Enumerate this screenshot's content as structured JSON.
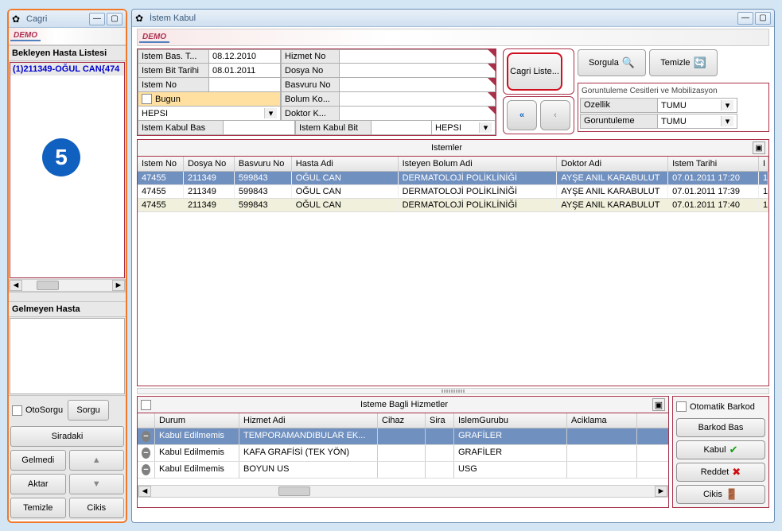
{
  "left": {
    "title": "Cagri",
    "logo": "DEMO",
    "section1": "Bekleyen Hasta Listesi",
    "waiting": [
      "(1)211349-OĞUL CAN{474"
    ],
    "big_number": "5",
    "section2": "Gelmeyen Hasta",
    "otosorgu": "OtoSorgu",
    "buttons": {
      "sorgu": "Sorgu",
      "siradaki": "Siradaki",
      "gelmedi": "Gelmedi",
      "aktar": "Aktar",
      "temizle": "Temizle",
      "cikis": "Cikis"
    }
  },
  "right": {
    "title": "İstem Kabul",
    "logo": "DEMO",
    "form": {
      "istem_bas_t_label": "Istem Bas. T...",
      "istem_bas_t": "08.12.2010",
      "istem_bit_label": "Istem Bit Tarihi",
      "istem_bit": "08.01.2011",
      "istem_no_label": "Istem No",
      "istem_no": "",
      "bugun": "Bugun",
      "hepsi": "HEPSI",
      "hizmet_no_label": "Hizmet No",
      "dosya_no_label": "Dosya No",
      "basvuru_no_label": "Basvuru No",
      "bolum_ko_label": "Bolum Ko...",
      "doktor_k_label": "Doktor K...",
      "istem_kabul_bas": "Istem Kabul Bas",
      "istem_kabul_bit": "Istem Kabul Bit",
      "hepsi2": "HEPSI"
    },
    "cagri_liste": "Cagri Liste...",
    "sorgula": "Sorgula",
    "temizle": "Temizle",
    "gorunt": {
      "title": "Goruntuleme Cesitleri ve Mobilizasyon",
      "ozellik_label": "Ozellik",
      "ozellik": "TUMU",
      "goruntuleme_label": "Goruntuleme",
      "goruntuleme": "TUMU"
    },
    "grid_title": "Istemler",
    "grid_cols": {
      "istem_no": "Istem No",
      "dosya_no": "Dosya No",
      "basvuru_no": "Basvuru No",
      "hasta_adi": "Hasta Adi",
      "isteyen_bolum": "Isteyen Bolum Adi",
      "doktor_adi": "Doktor Adi",
      "istem_tarihi": "Istem Tarihi",
      "i": "I"
    },
    "grid_rows": [
      {
        "istem": "47455",
        "dosya": "211349",
        "basv": "599843",
        "hasta": "OĞUL CAN",
        "bolum": "DERMATOLOJİ POLİKLİNİĞİ",
        "doktor": "AYŞE ANIL KARABULUT",
        "tarih": "07.01.2011 17:20",
        "i": "1"
      },
      {
        "istem": "47455",
        "dosya": "211349",
        "basv": "599843",
        "hasta": "OĞUL CAN",
        "bolum": "DERMATOLOJİ POLİKLİNİĞİ",
        "doktor": "AYŞE ANIL KARABULUT",
        "tarih": "07.01.2011 17:39",
        "i": "1"
      },
      {
        "istem": "47455",
        "dosya": "211349",
        "basv": "599843",
        "hasta": "OĞUL CAN",
        "bolum": "DERMATOLOJİ POLİKLİNİĞİ",
        "doktor": "AYŞE ANIL KARABULUT",
        "tarih": "07.01.2011 17:40",
        "i": "1"
      }
    ],
    "sub_title": "Isteme Bagli Hizmetler",
    "sub_cols": {
      "durum": "Durum",
      "hizmet": "Hizmet Adi",
      "cihaz": "Cihaz",
      "sira": "Sira",
      "islem": "IslemGurubu",
      "aciklama": "Aciklama"
    },
    "sub_rows": [
      {
        "durum": "Kabul Edilmemis",
        "hizmet": "TEMPORAMANDIBULAR EK...",
        "cihaz": "",
        "sira": "",
        "islem": "GRAFİLER",
        "acik": ""
      },
      {
        "durum": "Kabul Edilmemis",
        "hizmet": "KAFA GRAFİSİ (TEK YÖN)",
        "cihaz": "",
        "sira": "",
        "islem": "GRAFİLER",
        "acik": ""
      },
      {
        "durum": "Kabul Edilmemis",
        "hizmet": "BOYUN US",
        "cihaz": "",
        "sira": "",
        "islem": "USG",
        "acik": ""
      }
    ],
    "rpanel": {
      "oto_barkod": "Otomatik Barkod",
      "barkod_bas": "Barkod Bas",
      "kabul": "Kabul",
      "reddet": "Reddet",
      "cikis": "Cikis"
    }
  }
}
